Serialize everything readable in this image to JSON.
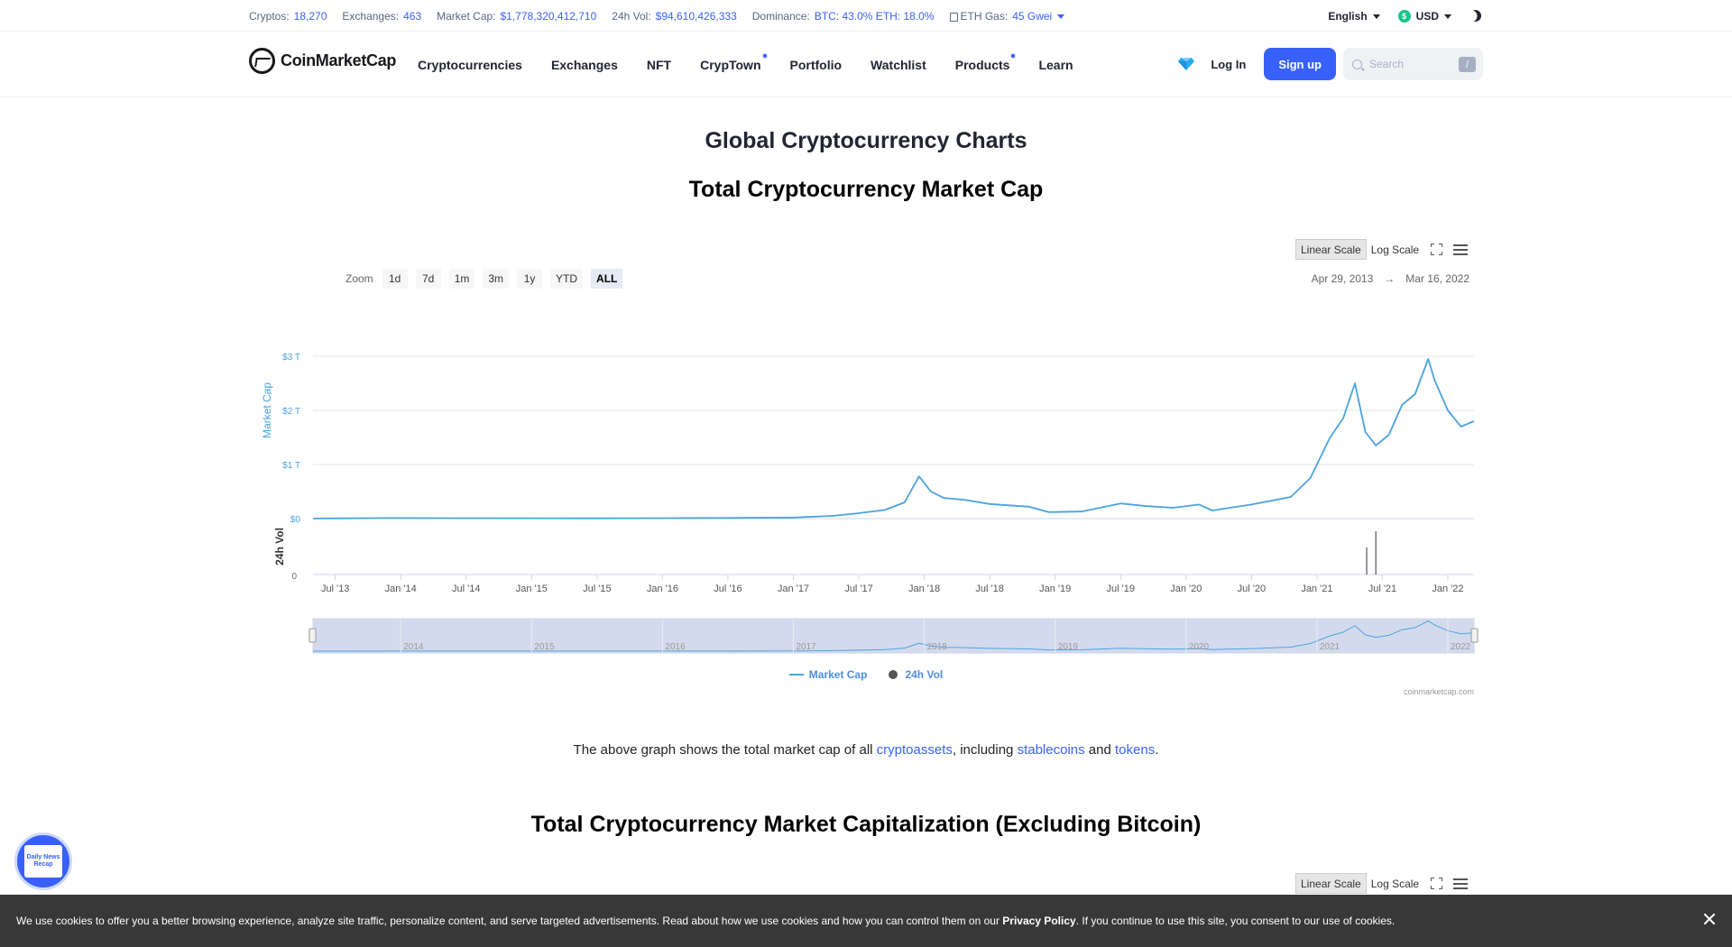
{
  "statsbar": {
    "cryptos_label": "Cryptos:",
    "cryptos": "18,270",
    "exchanges_label": "Exchanges:",
    "exchanges": "463",
    "mcap_label": "Market Cap:",
    "mcap": "$1,778,320,412,710",
    "vol_label": "24h Vol:",
    "vol": "$94,610,426,333",
    "dom_label": "Dominance:",
    "dom": "BTC: 43.0% ETH: 18.0%",
    "gas_label": "ETH Gas:",
    "gas": "45 Gwei",
    "language": "English",
    "currency": "USD",
    "currency_symbol": "$"
  },
  "nav": {
    "logo": "CoinMarketCap",
    "links": [
      "Cryptocurrencies",
      "Exchanges",
      "NFT",
      "CrypTown",
      "Portfolio",
      "Watchlist",
      "Products",
      "Learn"
    ],
    "login": "Log In",
    "signup": "Sign up",
    "search_placeholder": "Search",
    "search_shortcut": "/"
  },
  "page": {
    "title": "Global Cryptocurrency Charts",
    "chart1_title": "Total Cryptocurrency Market Cap",
    "chart2_title": "Total Cryptocurrency Market Capitalization (Excluding Bitcoin)",
    "desc_prefix": "The above graph shows the total market cap of all ",
    "desc_link1": "cryptoassets",
    "desc_mid1": ", including ",
    "desc_link2": "stablecoins",
    "desc_mid2": " and ",
    "desc_link3": "tokens",
    "desc_suffix": "."
  },
  "chart_toolbar": {
    "linear": "Linear Scale",
    "log": "Log Scale",
    "zoom_label": "Zoom",
    "zoom_options": [
      "1d",
      "7d",
      "1m",
      "3m",
      "1y",
      "YTD",
      "ALL"
    ],
    "zoom_active": "ALL",
    "range_from": "Apr 29, 2013",
    "range_arrow": "→",
    "range_to": "Mar 16, 2022",
    "credits": "coinmarketcap.com"
  },
  "chart_data": {
    "type": "line",
    "title": "Total Cryptocurrency Market Cap",
    "ylabel": "Market Cap",
    "ylabel2": "24h Vol",
    "y_ticks": [
      "$0",
      "$1 T",
      "$2 T",
      "$3 T"
    ],
    "y2_ticks": [
      "0"
    ],
    "ylim": [
      0,
      3
    ],
    "x_ticks": [
      "Jul '13",
      "Jan '14",
      "Jul '14",
      "Jan '15",
      "Jul '15",
      "Jan '16",
      "Jul '16",
      "Jan '17",
      "Jul '17",
      "Jan '18",
      "Jul '18",
      "Jan '19",
      "Jul '19",
      "Jan '20",
      "Jul '20",
      "Jan '21",
      "Jul '21",
      "Jan '22"
    ],
    "navigator_years": [
      "2014",
      "2015",
      "2016",
      "2017",
      "2018",
      "2019",
      "2020",
      "2021",
      "2022"
    ],
    "series": [
      {
        "name": "Market Cap",
        "color": "#4aa3df",
        "x": [
          2013.33,
          2013.9,
          2014.5,
          2015.0,
          2015.5,
          2016.0,
          2016.5,
          2017.0,
          2017.3,
          2017.5,
          2017.7,
          2017.85,
          2017.96,
          2018.05,
          2018.15,
          2018.3,
          2018.5,
          2018.8,
          2018.95,
          2019.2,
          2019.5,
          2019.7,
          2019.9,
          2020.1,
          2020.2,
          2020.5,
          2020.8,
          2020.95,
          2021.1,
          2021.2,
          2021.29,
          2021.37,
          2021.45,
          2021.55,
          2021.65,
          2021.75,
          2021.85,
          2021.9,
          2022.0,
          2022.1,
          2022.2
        ],
        "values": [
          0.002,
          0.01,
          0.008,
          0.006,
          0.005,
          0.008,
          0.012,
          0.02,
          0.05,
          0.1,
          0.16,
          0.3,
          0.78,
          0.5,
          0.38,
          0.35,
          0.27,
          0.22,
          0.12,
          0.13,
          0.28,
          0.23,
          0.2,
          0.26,
          0.15,
          0.26,
          0.4,
          0.75,
          1.5,
          1.85,
          2.5,
          1.6,
          1.35,
          1.55,
          2.1,
          2.3,
          2.95,
          2.55,
          2.0,
          1.7,
          1.8
        ]
      },
      {
        "name": "24h Vol",
        "color": "#555555",
        "x": [
          2021.38,
          2021.45
        ],
        "values": [
          0.5,
          0.8
        ]
      }
    ],
    "legend_position": "bottom",
    "grid": true
  },
  "news_badge": {
    "text": "Daily News Recap"
  },
  "cookie": {
    "text_before": "We use cookies to offer you a better browsing experience, analyze site traffic, personalize content, and serve targeted advertisements. Read about how we use cookies and how you can control them on our ",
    "link": "Privacy Policy",
    "text_after": ". If you continue to use this site, you consent to our use of cookies."
  }
}
